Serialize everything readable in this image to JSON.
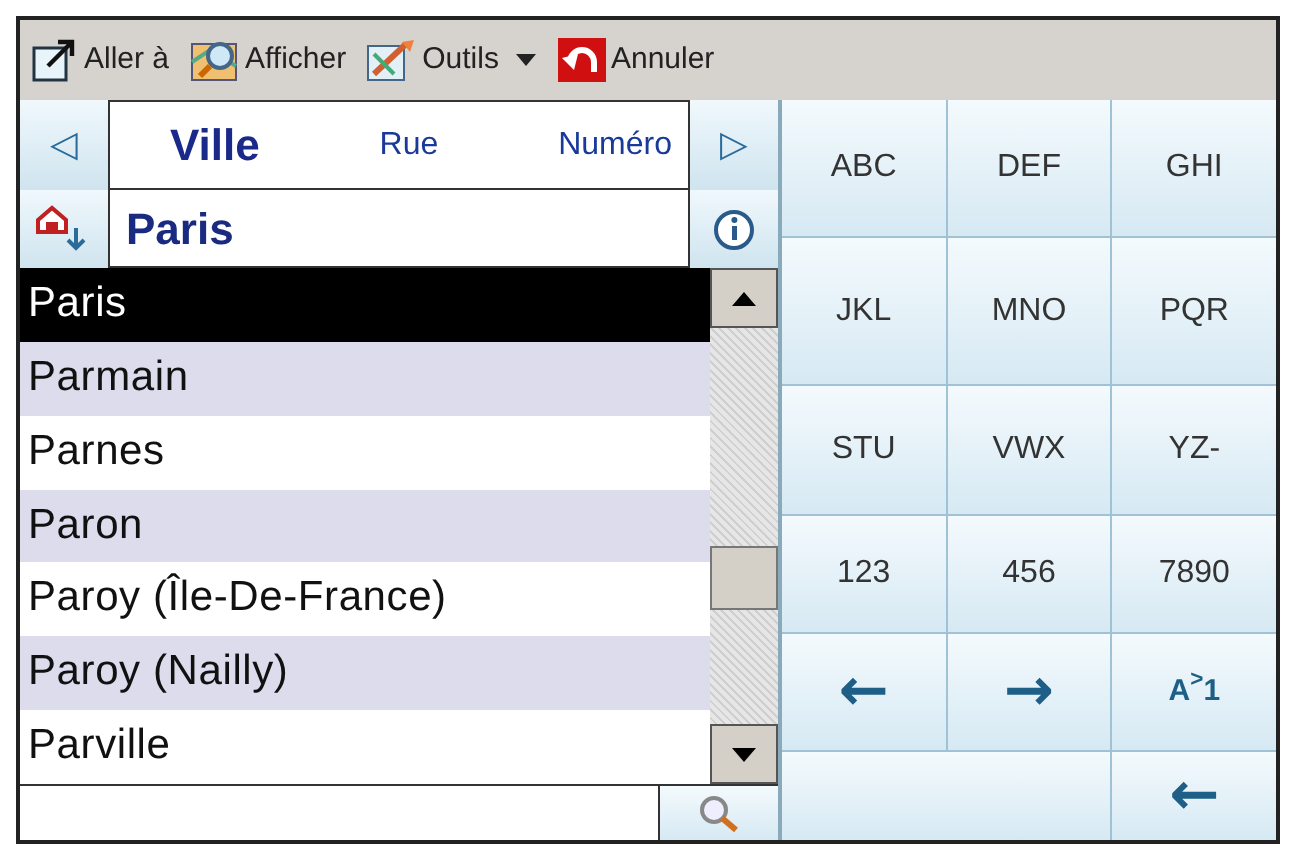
{
  "toolbar": [
    {
      "label": "Aller à"
    },
    {
      "label": "Afficher"
    },
    {
      "label": "Outils",
      "dropdown": true
    },
    {
      "label": "Annuler"
    }
  ],
  "nav": {
    "prev": "◁",
    "next": "▷"
  },
  "tabs": [
    {
      "label": "Ville",
      "selected": true
    },
    {
      "label": "Rue",
      "selected": false
    },
    {
      "label": "Numéro",
      "selected": false
    }
  ],
  "search_value": "Paris",
  "results": [
    {
      "name": "Paris",
      "selected": true
    },
    {
      "name": "Parmain",
      "selected": false
    },
    {
      "name": "Parnes",
      "selected": false
    },
    {
      "name": "Paron",
      "selected": false
    },
    {
      "name": "Paroy (Île-De-France)",
      "selected": false
    },
    {
      "name": "Paroy (Nailly)",
      "selected": false
    },
    {
      "name": "Parville",
      "selected": false
    }
  ],
  "keys": [
    {
      "kind": "text",
      "label": "ABC"
    },
    {
      "kind": "text",
      "label": "DEF"
    },
    {
      "kind": "text",
      "label": "GHI"
    },
    {
      "kind": "text",
      "label": "JKL"
    },
    {
      "kind": "text",
      "label": "MNO"
    },
    {
      "kind": "text",
      "label": "PQR"
    },
    {
      "kind": "text",
      "label": "STU"
    },
    {
      "kind": "text",
      "label": "VWX"
    },
    {
      "kind": "text",
      "label": "YZ-"
    },
    {
      "kind": "text",
      "label": "123"
    },
    {
      "kind": "text",
      "label": "456"
    },
    {
      "kind": "text",
      "label": "7890"
    },
    {
      "kind": "arrow",
      "label": "←"
    },
    {
      "kind": "arrow",
      "label": "→"
    },
    {
      "kind": "mode",
      "label": "A$^{>}$1"
    },
    {
      "kind": "blank"
    },
    {
      "kind": "arrow",
      "label": "←"
    }
  ]
}
